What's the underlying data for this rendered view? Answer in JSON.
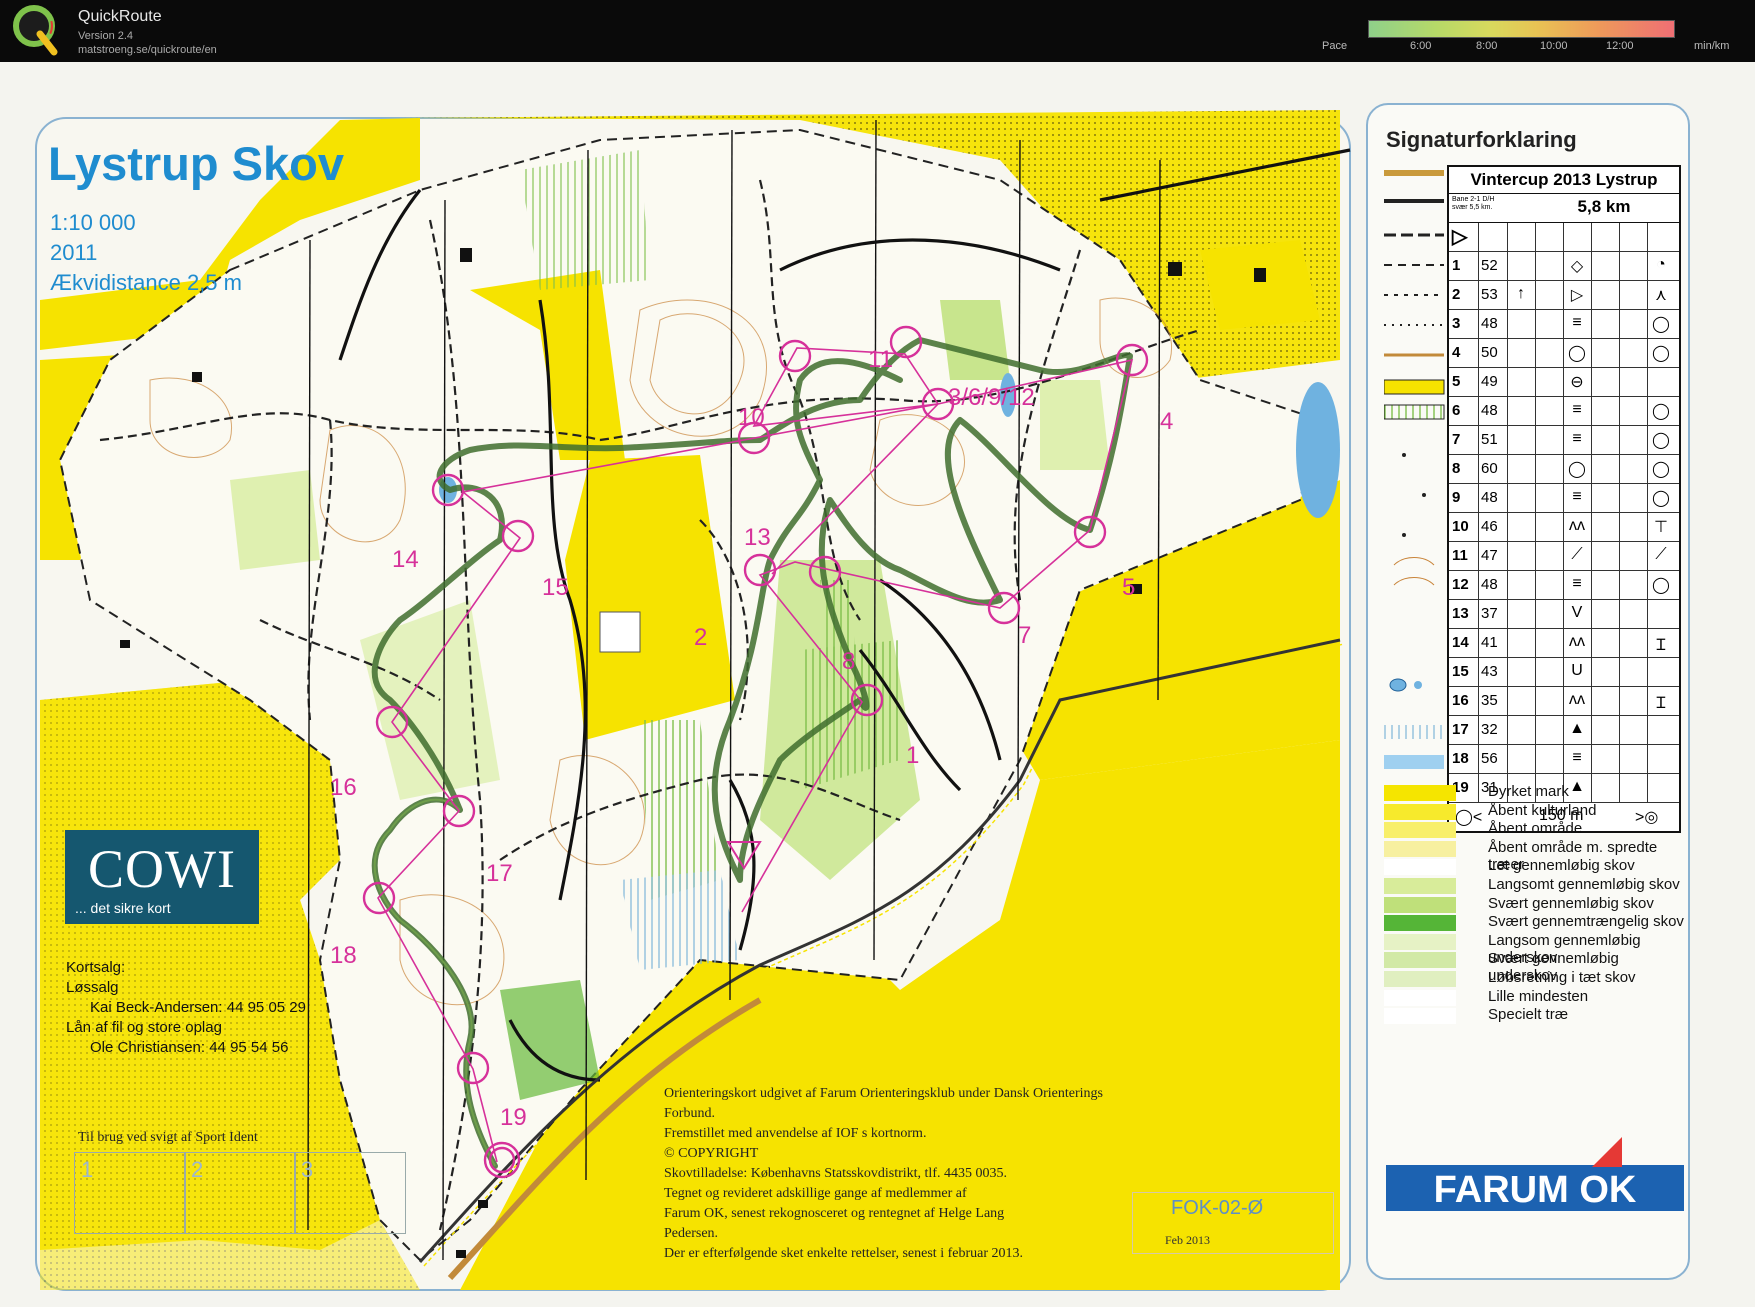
{
  "app": {
    "name": "QuickRoute",
    "version": "Version 2.4",
    "url": "matstroeng.se/quickroute/en"
  },
  "pace": {
    "label": "Pace",
    "ticks": [
      "6:00",
      "8:00",
      "10:00",
      "12:00"
    ],
    "unit": "min/km"
  },
  "map": {
    "title": "Lystrup Skov",
    "scale": "1:10 000",
    "year": "2011",
    "contour": "Ækvidistance 2,5 m",
    "controls": [
      {
        "label": "1"
      },
      {
        "label": "2"
      },
      {
        "label": "3/6/9/12"
      },
      {
        "label": "4"
      },
      {
        "label": "5"
      },
      {
        "label": "7"
      },
      {
        "label": "8"
      },
      {
        "label": "10"
      },
      {
        "label": "11"
      },
      {
        "label": "13"
      },
      {
        "label": "14"
      },
      {
        "label": "15"
      },
      {
        "label": "16"
      },
      {
        "label": "17"
      },
      {
        "label": "18"
      },
      {
        "label": "19"
      }
    ]
  },
  "cowi": {
    "name": "COWI",
    "tagline": "... det sikre kort"
  },
  "sales": {
    "heading": "Kortsalg:",
    "single": "Løssalg",
    "single_contact": "Kai Beck-Andersen: 44 95 05 29",
    "loan": "Lån af fil og store oplag",
    "loan_contact": "Ole Christiansen: 44 95 54 56"
  },
  "sportident": {
    "title": "Til brug ved svigt af Sport Ident",
    "boxes": [
      "1",
      "2",
      "3"
    ]
  },
  "credits": [
    "Orienteringskort udgivet af Farum Orienteringsklub under Dansk Orienterings Forbund.",
    "Fremstillet med anvendelse af IOF s kortnorm.",
    "© COPYRIGHT",
    "Skovtilladelse: Københavns Statsskovdistrikt, tlf. 4435 0035.",
    "Tegnet og revideret adskillige gange af medlemmer af",
    "Farum OK, senest rekognosceret og rentegnet af Helge Lang",
    "Pedersen.",
    "Der er efterfølgende sket enkelte rettelser, senest i februar 2013."
  ],
  "map_code": {
    "code": "FOK-02-Ø",
    "date": "Feb 2013"
  },
  "legend": {
    "title": "Signaturforklaring",
    "items": [
      "Dyrket mark",
      "Åbent kulturland",
      "Åbent område",
      "Åbent område m. spredte træer",
      "Let gennemløbig skov",
      "Langsomt gennemløbig skov",
      "Svært gennemløbig skov",
      "Svært gennemtrængelig skov",
      "Langsom gennemløbig underskov",
      "Svært gennemløbig underskov",
      "Løbsretning i tæt skov",
      "Lille mindesten",
      "Specielt træ"
    ],
    "swatch_colors": [
      "#f5e500",
      "#f7ea2c",
      "#f8ef6a",
      "#f7f0a0",
      "#ffffff",
      "#d8ec9a",
      "#bfe07a",
      "#55b537",
      "#e6f2c5",
      "#d2e9a6",
      "#e0efc0",
      "#ffffff",
      "#ffffff"
    ]
  },
  "control_description": {
    "title": "Vintercup 2013 Lystrup",
    "course": "Bane 2-1 D/H svær 5,5 km.",
    "length": "5,8 km",
    "start_symbol": "▷",
    "rows": [
      {
        "no": "1",
        "code": "52",
        "c": "",
        "d": "◇",
        "g": "◔"
      },
      {
        "no": "2",
        "code": "53",
        "c": "↑",
        "d": "▷",
        "g": "⋏"
      },
      {
        "no": "3",
        "code": "48",
        "c": "",
        "d": "≡",
        "g": "◯"
      },
      {
        "no": "4",
        "code": "50",
        "c": "",
        "d": "◯",
        "g": "◯"
      },
      {
        "no": "5",
        "code": "49",
        "c": "",
        "d": "⊖",
        "g": ""
      },
      {
        "no": "6",
        "code": "48",
        "c": "",
        "d": "≡",
        "g": "◯"
      },
      {
        "no": "7",
        "code": "51",
        "c": "",
        "d": "≡",
        "g": "◯"
      },
      {
        "no": "8",
        "code": "60",
        "c": "",
        "d": "◯",
        "g": "◯"
      },
      {
        "no": "9",
        "code": "48",
        "c": "",
        "d": "≡",
        "g": "◯"
      },
      {
        "no": "10",
        "code": "46",
        "c": "",
        "d": "ʌʌ",
        "g": "⊤"
      },
      {
        "no": "11",
        "code": "47",
        "c": "",
        "d": "⟋",
        "g": "⟋"
      },
      {
        "no": "12",
        "code": "48",
        "c": "",
        "d": "≡",
        "g": "◯"
      },
      {
        "no": "13",
        "code": "37",
        "c": "",
        "d": "V",
        "g": ""
      },
      {
        "no": "14",
        "code": "41",
        "c": "",
        "d": "ʌʌ",
        "g": "Ɪ"
      },
      {
        "no": "15",
        "code": "43",
        "c": "",
        "d": "U",
        "g": ""
      },
      {
        "no": "16",
        "code": "35",
        "c": "",
        "d": "ʌʌ",
        "g": "Ɪ"
      },
      {
        "no": "17",
        "code": "32",
        "c": "",
        "d": "▲",
        "g": ""
      },
      {
        "no": "18",
        "code": "56",
        "c": "",
        "d": "≡",
        "g": ""
      },
      {
        "no": "19",
        "code": "31",
        "c": "",
        "d": "▲",
        "g": ""
      }
    ],
    "finish_distance": "150 m",
    "finish_left": "◯<",
    "finish_right": ">◎"
  },
  "club": {
    "name": "FARUM OK"
  },
  "colors": {
    "map_yellow": "#f6e300",
    "course_magenta": "#d6319a",
    "route_green": "#3f6d2e",
    "title_blue": "#1f8ccf"
  }
}
